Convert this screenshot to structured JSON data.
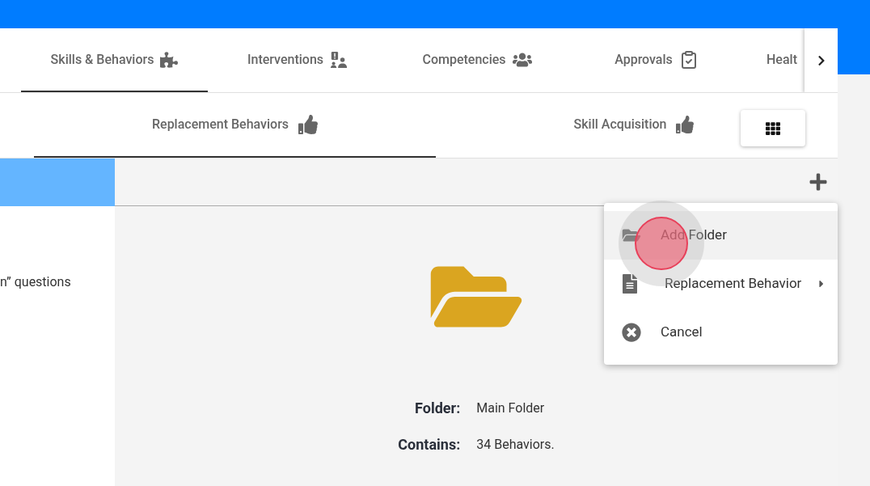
{
  "tabs": [
    {
      "label": "Skills & Behaviors",
      "selected": true
    },
    {
      "label": "Interventions",
      "selected": false
    },
    {
      "label": "Competencies",
      "selected": false
    },
    {
      "label": "Approvals",
      "selected": false
    },
    {
      "label": "Healt",
      "selected": false
    }
  ],
  "subtabs": [
    {
      "label": "Replacement Behaviors",
      "selected": true
    },
    {
      "label": "Skill Acquisition",
      "selected": false
    }
  ],
  "left_panel": {
    "text": "n” questions"
  },
  "folder": {
    "folder_label": "Folder:",
    "folder_value": "Main Folder",
    "contains_label": "Contains:",
    "contains_value": "34 Behaviors."
  },
  "menu": [
    {
      "kind": "folder",
      "label": "Add Folder",
      "highlighted": true,
      "submenu": false
    },
    {
      "kind": "document",
      "label": "Replacement Behavior",
      "highlighted": false,
      "submenu": true
    },
    {
      "kind": "cancel",
      "label": "Cancel",
      "highlighted": false,
      "submenu": false
    }
  ]
}
